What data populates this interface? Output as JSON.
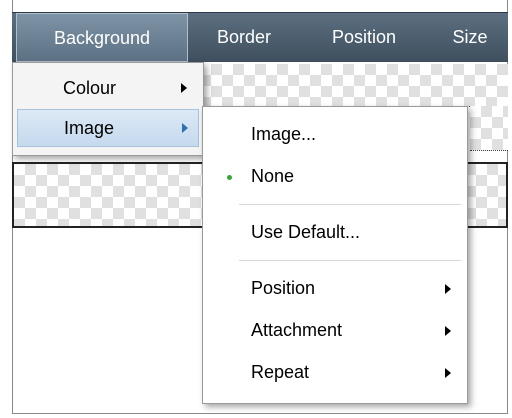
{
  "menubar": {
    "items": [
      {
        "label": "Background",
        "active": true
      },
      {
        "label": "Border"
      },
      {
        "label": "Position"
      },
      {
        "label": "Size"
      }
    ]
  },
  "background_menu": {
    "items": [
      {
        "label": "Colour",
        "has_submenu": true
      },
      {
        "label": "Image",
        "has_submenu": true,
        "highlighted": true
      }
    ]
  },
  "image_submenu": {
    "items": [
      {
        "label": "Image..."
      },
      {
        "label": "None",
        "selected": true
      },
      {
        "label": "Use Default..."
      },
      {
        "label": "Position",
        "has_submenu": true
      },
      {
        "label": "Attachment",
        "has_submenu": true
      },
      {
        "label": "Repeat",
        "has_submenu": true
      }
    ]
  },
  "colors": {
    "menubar": "#4a5b6b",
    "active_tab": "#6f8498",
    "highlight": "#cfe0f3",
    "selected_bullet": "#3aa63a"
  }
}
